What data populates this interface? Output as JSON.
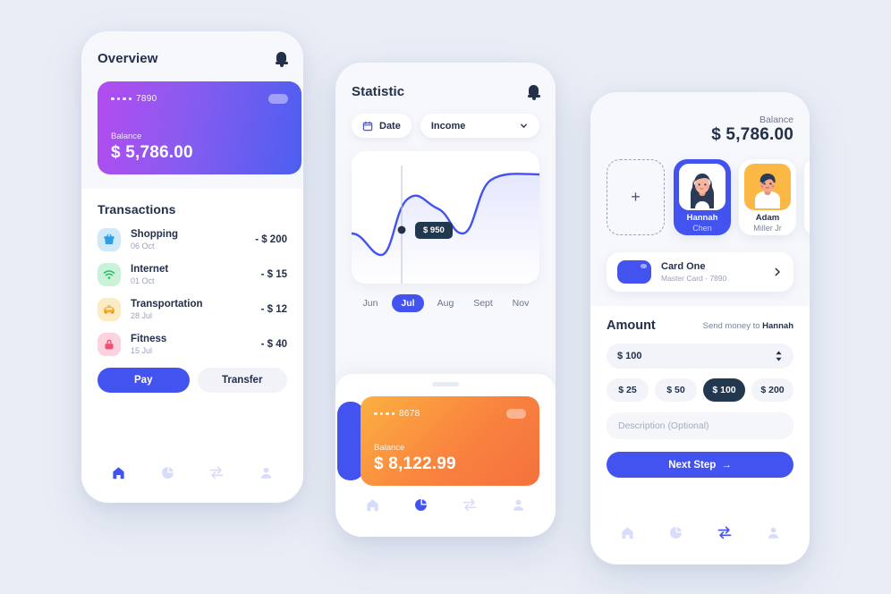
{
  "theme": {
    "background": "#e9edf6",
    "accent_blue": "#4353f0",
    "dark_navy": "#23304a",
    "card_purple_from": "#b34bf0",
    "card_purple_to": "#4c5ff0",
    "card_orange_from": "#fbb040",
    "card_orange_to": "#f4713e",
    "chip_selected": "#22384f"
  },
  "overview": {
    "title": "Overview",
    "bell_icon": "bell-icon",
    "card": {
      "masked_number": "7890",
      "balance_label": "Balance",
      "balance_value": "$ 5,786.00"
    },
    "transactions_title": "Transactions",
    "transactions": [
      {
        "icon": "shopping-basket-icon",
        "name": "Shopping",
        "date": "06 Oct",
        "amount": "- $ 200"
      },
      {
        "icon": "wifi-icon",
        "name": "Internet",
        "date": "01 Oct",
        "amount": "- $ 15"
      },
      {
        "icon": "taxi-icon",
        "name": "Transportation",
        "date": "28 Jul",
        "amount": "- $ 12"
      },
      {
        "icon": "fitness-icon",
        "name": "Fitness",
        "date": "15 Jul",
        "amount": "- $ 40"
      }
    ],
    "pay_label": "Pay",
    "transfer_label": "Transfer",
    "nav": [
      {
        "icon": "home-icon",
        "active": true
      },
      {
        "icon": "chart-icon",
        "active": false
      },
      {
        "icon": "transfer-icon",
        "active": false
      },
      {
        "icon": "profile-icon",
        "active": false
      }
    ]
  },
  "statistic": {
    "title": "Statistic",
    "bell_icon": "bell-icon",
    "date_filter": {
      "icon": "calendar-icon",
      "label": "Date"
    },
    "type_filter": {
      "label": "Income",
      "icon": "chevron-down-icon"
    },
    "tooltip": "$ 950",
    "card": {
      "masked_number": "8678",
      "balance_label": "Balance",
      "balance_value": "$ 8,122.99"
    },
    "nav": [
      {
        "icon": "home-icon",
        "active": false
      },
      {
        "icon": "chart-icon",
        "active": true
      },
      {
        "icon": "transfer-icon",
        "active": false
      },
      {
        "icon": "profile-icon",
        "active": false
      }
    ]
  },
  "chart_data": {
    "type": "line",
    "title": "",
    "xlabel": "",
    "ylabel": "",
    "categories": [
      "Jun",
      "Jul",
      "Aug",
      "Sept",
      "Nov"
    ],
    "selected_category": "Jul",
    "highlight_point": {
      "x_label": "Jul",
      "value": 950,
      "display": "$ 950"
    },
    "x": [
      0,
      0.5,
      1,
      1.5,
      2,
      2.5,
      3,
      3.5,
      4
    ],
    "values": [
      950,
      870,
      950,
      1180,
      1150,
      1060,
      1180,
      1380,
      1400
    ],
    "ylim": [
      700,
      1500
    ],
    "grid": false,
    "legend": "none",
    "area_fill": true,
    "line_color": "#4353f0"
  },
  "transfer": {
    "balance_label": "Balance",
    "balance_value": "$ 5,786.00",
    "add_contact_label": "+",
    "contacts": [
      {
        "first": "Hannah",
        "last": "Chen",
        "selected": true,
        "avatar": "avatar-hannah"
      },
      {
        "first": "Adam",
        "last": "Miller Jr",
        "selected": false,
        "avatar": "avatar-adam"
      }
    ],
    "card_select": {
      "name": "Card One",
      "sub": "Master Card - 7890",
      "chevron_icon": "chevron-right-icon"
    },
    "amount_heading": "Amount",
    "send_prefix": "Send money to ",
    "send_to": "Hannah",
    "amount_value": "$ 100",
    "stepper_icon": "stepper-updown-icon",
    "quick_amounts": [
      {
        "label": "$ 25",
        "selected": false
      },
      {
        "label": "$ 50",
        "selected": false
      },
      {
        "label": "$ 100",
        "selected": true
      },
      {
        "label": "$ 200",
        "selected": false
      }
    ],
    "description_placeholder": "Description (Optional)",
    "next_label": "Next Step",
    "next_arrow": "→",
    "nav": [
      {
        "icon": "home-icon",
        "active": false
      },
      {
        "icon": "chart-icon",
        "active": false
      },
      {
        "icon": "transfer-icon",
        "active": true
      },
      {
        "icon": "profile-icon",
        "active": false
      }
    ]
  }
}
